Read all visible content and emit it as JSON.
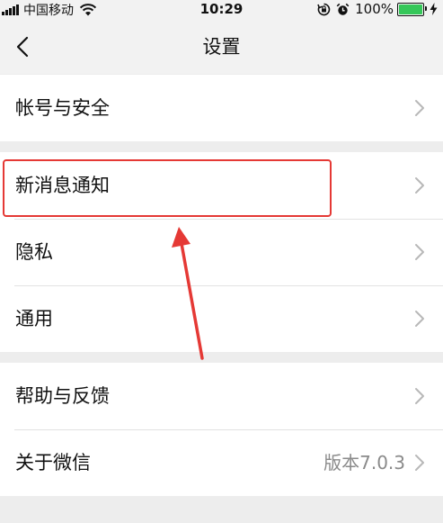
{
  "status_bar": {
    "carrier": "中国移动",
    "time": "10:29",
    "battery_percent": "100%"
  },
  "nav": {
    "title": "设置"
  },
  "groups": [
    {
      "items": [
        {
          "label": "帐号与安全"
        }
      ]
    },
    {
      "items": [
        {
          "label": "新消息通知"
        },
        {
          "label": "隐私"
        },
        {
          "label": "通用"
        }
      ]
    },
    {
      "items": [
        {
          "label": "帮助与反馈"
        },
        {
          "label": "关于微信",
          "value": "版本7.0.3"
        }
      ]
    }
  ],
  "icons": {
    "back": "chevron-left-icon",
    "row_disclosure": "chevron-right-icon",
    "signal": "signal-bars-icon",
    "wifi": "wifi-icon",
    "rotation_lock": "rotation-lock-icon",
    "alarm": "alarm-icon",
    "battery": "battery-icon",
    "charging": "charging-bolt-icon"
  },
  "colors": {
    "background": "#ededed",
    "highlight": "#e53935",
    "battery_fill": "#35c759",
    "secondary_text": "#8a8a8a"
  }
}
